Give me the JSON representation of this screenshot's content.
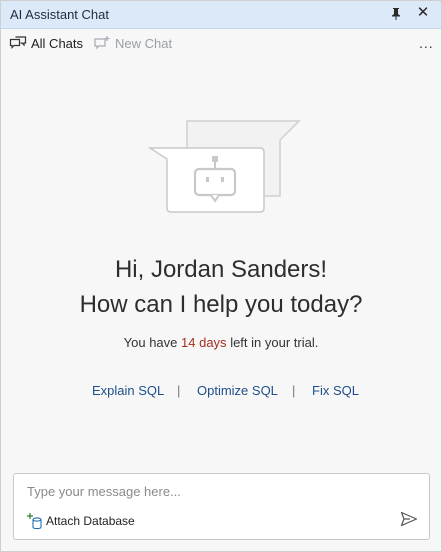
{
  "window": {
    "title": "AI Assistant Chat"
  },
  "titlebar_icons": [
    "pin-icon",
    "close-icon"
  ],
  "toolbar": {
    "all_chats": "All Chats",
    "new_chat": "New Chat",
    "more": "..."
  },
  "greeting": {
    "line1": "Hi, Jordan  Sanders!",
    "line2": "How can I help you today?"
  },
  "trial": {
    "prefix": "You have",
    "days": "14 days",
    "suffix": "left in your trial."
  },
  "quick_actions": {
    "explain": "Explain SQL",
    "optimize": "Optimize SQL",
    "fix": "Fix SQL",
    "separator": "|"
  },
  "composer": {
    "placeholder": "Type your message here...",
    "attach_label": "Attach Database"
  },
  "colors": {
    "titlebar_bg": "#dce9f8",
    "link": "#1f4f8b",
    "trial_days": "#a1301f"
  }
}
